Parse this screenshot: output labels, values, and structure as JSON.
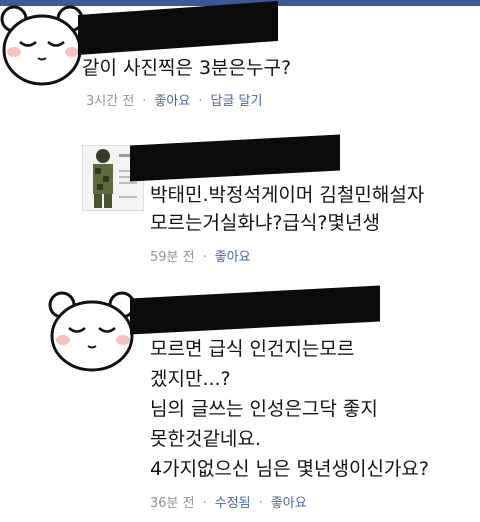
{
  "comments": [
    {
      "text": "같이 사진찍은 3분은누구?",
      "time": "3시간 전",
      "like": "좋아요",
      "reply": "답글 달기"
    },
    {
      "lines": [
        "박태민.박정석게이머 김철민해설자",
        "모르는거실화냐?급식?몇년생"
      ],
      "time": "59분 전",
      "like": "좋아요"
    },
    {
      "lines": [
        "모르면 급식 인건지는모르",
        "겠지만...?",
        "님의 글쓰는 인성은그닥 좋지",
        "못한것같네요.",
        "4가지없으신 님은 몇년생이신가요?"
      ],
      "time": "36분 전",
      "edited": "수정됨",
      "like": "좋아요"
    }
  ],
  "colors": {
    "link": "#4b67a1",
    "meta": "#90949c",
    "bar": "#3b5998"
  },
  "icons": [
    "sleepy-face-icon",
    "soldier-avatar-icon"
  ]
}
